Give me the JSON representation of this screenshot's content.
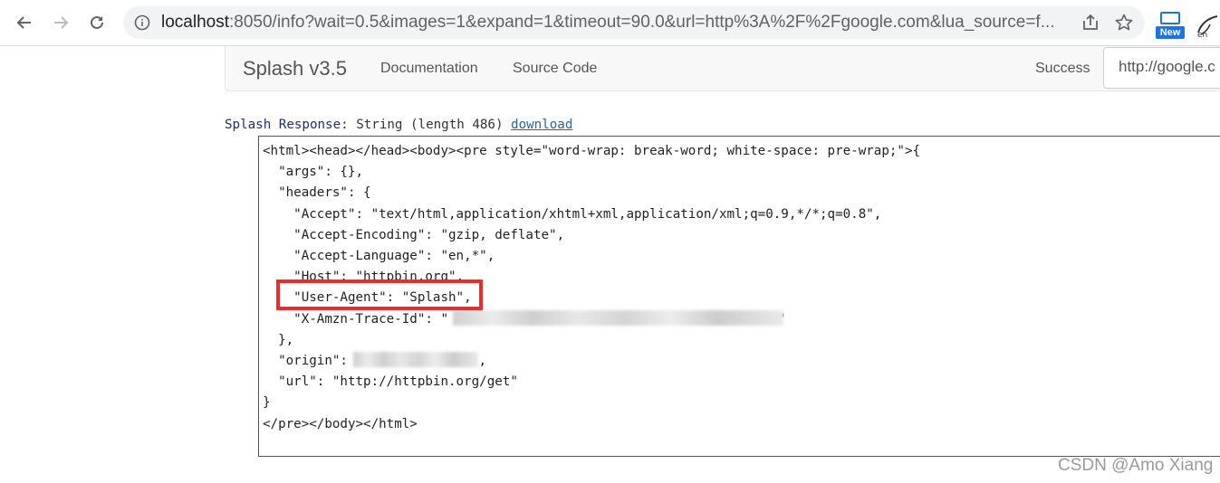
{
  "browser": {
    "url_host": "localhost",
    "url_rest": ":8050/info?wait=0.5&images=1&expand=1&timeout=90.0&url=http%3A%2F%2Fgoogle.com&lua_source=f...",
    "extension_badge": "New",
    "icons": [
      "back-arrow-icon",
      "forward-arrow-icon",
      "reload-icon",
      "info-icon",
      "share-icon",
      "star-icon",
      "translate-icon"
    ]
  },
  "navbar": {
    "brand": "Splash v3.5",
    "links": [
      "Documentation",
      "Source Code"
    ],
    "status": "Success",
    "url_input_value": "http://google.c"
  },
  "response": {
    "label_prefix": "Splash Response",
    "label_info": ": String (length 486) ",
    "download_link": "download",
    "lines": {
      "l1": "<html><head></head><body><pre style=\"word-wrap: break-word; white-space: pre-wrap;\">{",
      "l2": "  \"args\": {},",
      "l3": "  \"headers\": {",
      "l4": "    \"Accept\": \"text/html,application/xhtml+xml,application/xml;q=0.9,*/*;q=0.8\",",
      "l5": "    \"Accept-Encoding\": \"gzip, deflate\",",
      "l6": "    \"Accept-Language\": \"en,*\",",
      "l7": "    \"Host\": \"httpbin.org\",",
      "l8": "    \"User-Agent\": \"Splash\",",
      "l9a": "    \"X-Amzn-Trace-Id\": \"",
      "l9b": "\"",
      "l10": "  },",
      "l11a": "  \"origin\": ",
      "l11b": ",",
      "l12": "  \"url\": \"http://httpbin.org/get\"",
      "l13": "}",
      "l14": "</pre></body></html>"
    }
  },
  "watermark": "CSDN @Amo Xiang",
  "colors": {
    "highlight": "#ee2a2a",
    "link": "#2a6496",
    "badge": "#1a73e8"
  }
}
